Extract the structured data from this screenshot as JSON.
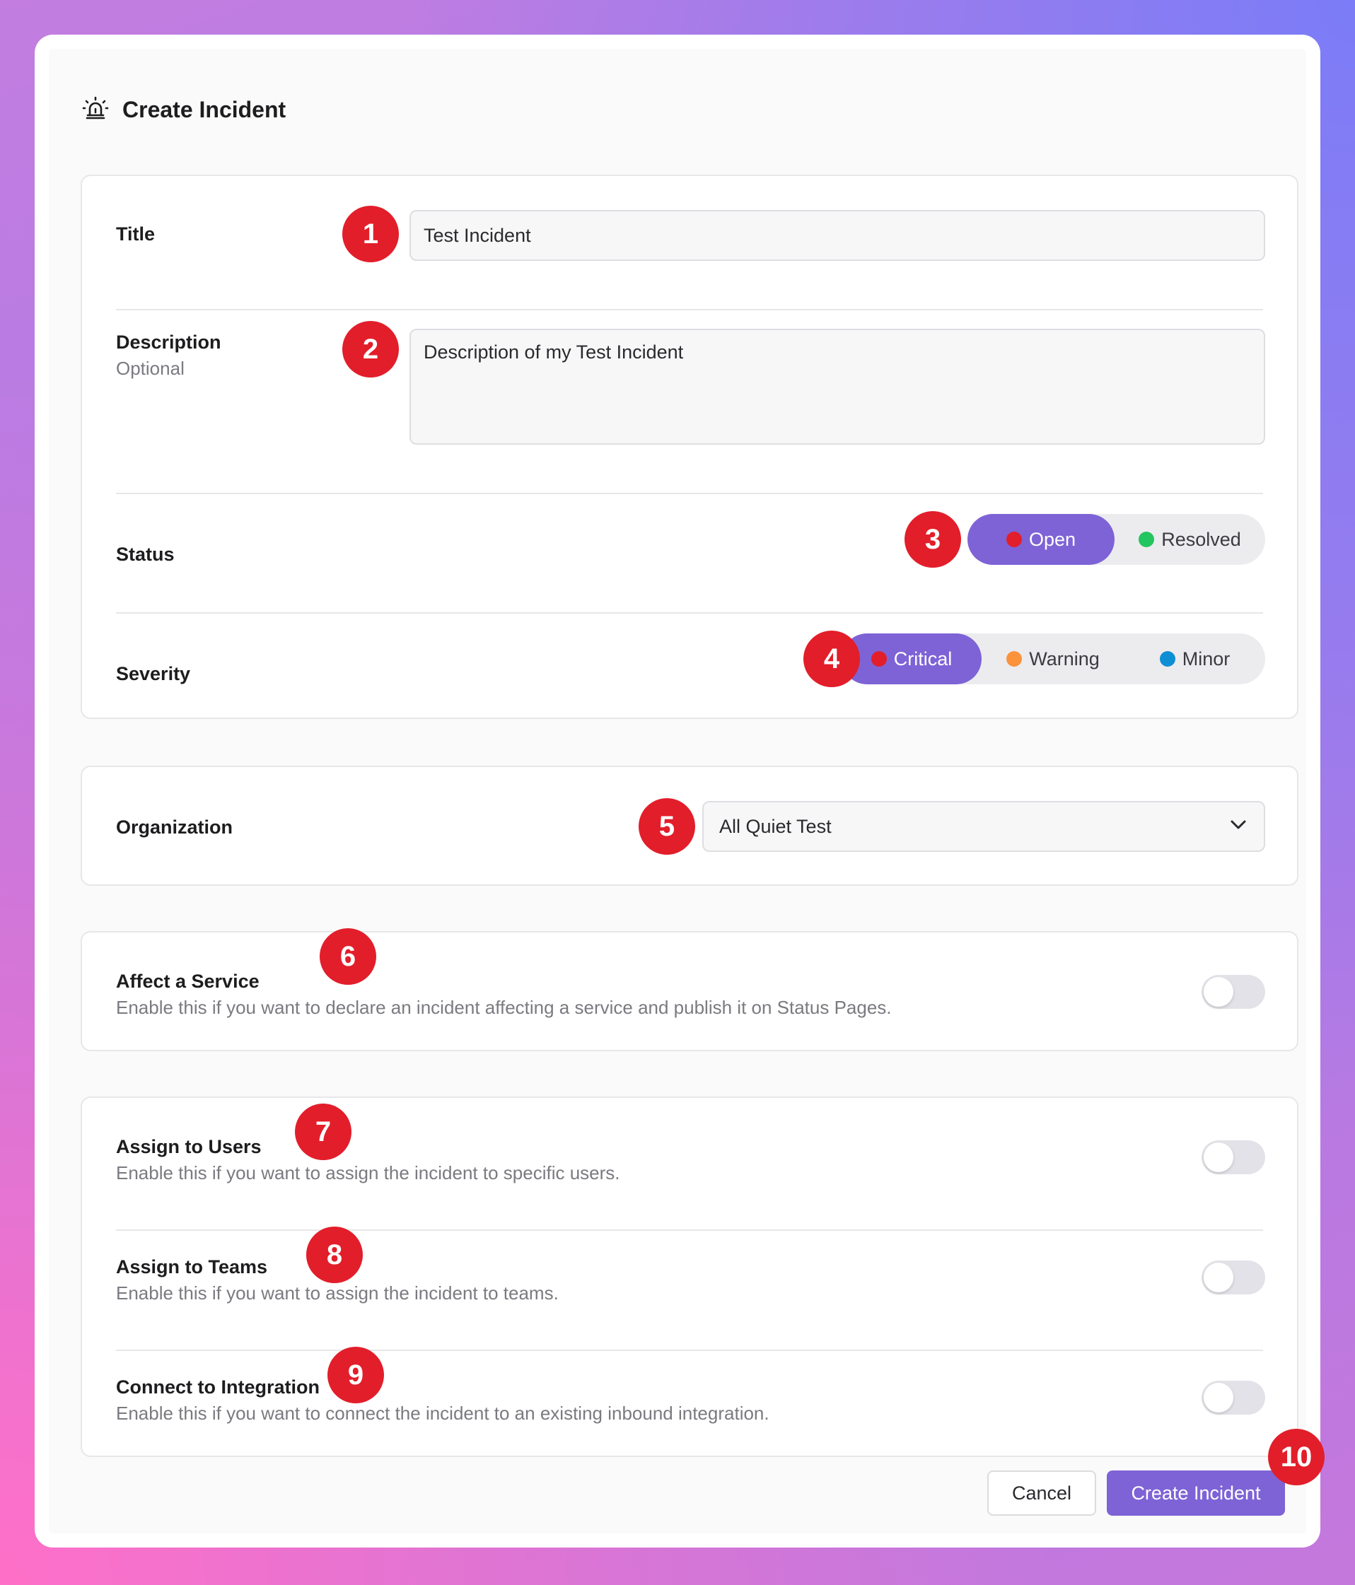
{
  "dialog": {
    "title": "Create Incident",
    "icon": "siren-icon"
  },
  "fields": {
    "title": {
      "label": "Title",
      "value": "Test Incident",
      "marker": "1"
    },
    "description": {
      "label": "Description",
      "sublabel": "Optional",
      "value": "Description of my Test Incident",
      "marker": "2"
    },
    "status": {
      "label": "Status",
      "marker": "3",
      "options": [
        {
          "label": "Open",
          "color": "#e21e2a",
          "selected": true
        },
        {
          "label": "Resolved",
          "color": "#22c55e",
          "selected": false
        }
      ]
    },
    "severity": {
      "label": "Severity",
      "marker": "4",
      "options": [
        {
          "label": "Critical",
          "color": "#e21e2a",
          "selected": true
        },
        {
          "label": "Warning",
          "color": "#fb923c",
          "selected": false
        },
        {
          "label": "Minor",
          "color": "#0e8fd4",
          "selected": false
        }
      ]
    },
    "organization": {
      "label": "Organization",
      "value": "All Quiet Test",
      "marker": "5"
    }
  },
  "toggles": {
    "service": {
      "label": "Affect a Service",
      "description": "Enable this if you want to declare an incident affecting a service and publish it on Status Pages.",
      "marker": "6",
      "on": false
    },
    "users": {
      "label": "Assign to Users",
      "description": "Enable this if you want to assign the incident to specific users.",
      "marker": "7",
      "on": false
    },
    "teams": {
      "label": "Assign to Teams",
      "description": "Enable this if you want to assign the incident to teams.",
      "marker": "8",
      "on": false
    },
    "integration": {
      "label": "Connect to Integration",
      "description": "Enable this if you want to connect the incident to an existing inbound integration.",
      "marker": "9",
      "on": false
    }
  },
  "actions": {
    "cancel": "Cancel",
    "submit": "Create Incident",
    "marker": "10"
  },
  "colors": {
    "accent": "#7e63d6",
    "marker": "#e21e2a"
  }
}
